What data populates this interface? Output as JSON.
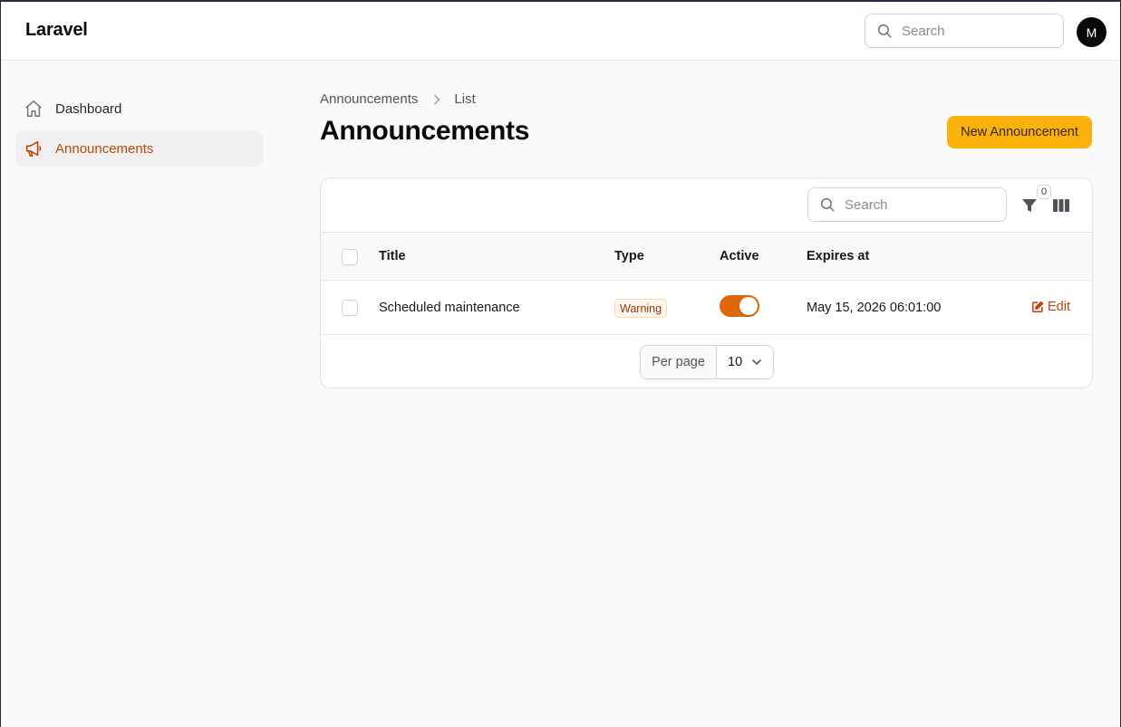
{
  "app": {
    "brand": "Laravel"
  },
  "topbar": {
    "search_placeholder": "Search",
    "avatar_initial": "M"
  },
  "sidebar": {
    "items": [
      {
        "label": "Dashboard",
        "icon": "home-icon",
        "active": false
      },
      {
        "label": "Announcements",
        "icon": "megaphone-icon",
        "active": true
      }
    ]
  },
  "breadcrumb": {
    "items": [
      "Announcements",
      "List"
    ]
  },
  "page": {
    "title": "Announcements",
    "new_button_label": "New Announcement"
  },
  "table": {
    "search_placeholder": "Search",
    "filter_count": "0",
    "columns": [
      "Title",
      "Type",
      "Active",
      "Expires at"
    ],
    "rows": [
      {
        "title": "Scheduled maintenance",
        "type": "Warning",
        "active": true,
        "expires_at": "May 15, 2026 06:01:00",
        "action_label": "Edit"
      }
    ],
    "pagination": {
      "per_page_label": "Per page",
      "per_page_value": "10"
    }
  },
  "colors": {
    "accent": "#fbb20c",
    "active_text": "#b94a05",
    "toggle_on": "#e0680c",
    "warning_badge_text": "#9a3412"
  }
}
